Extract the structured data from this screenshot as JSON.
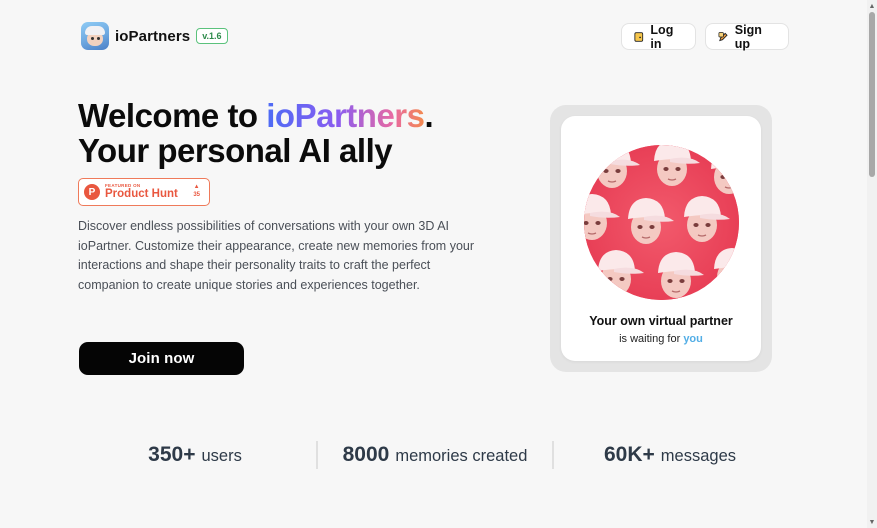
{
  "header": {
    "brand_name": "ioPartners",
    "version": "v.1.6",
    "login_label": "Log in",
    "signup_label": "Sign up"
  },
  "hero": {
    "title_prefix": "Welcome to ",
    "title_brand": "ioPartners",
    "title_suffix": ".",
    "title_line2": "Your personal AI ally",
    "description": "Discover endless possibilities of conversations with your own 3D AI ioPartner. Customize their appearance, create new memories from your interactions and shape their personality traits to craft the perfect companion to create unique stories and experiences together.",
    "join_label": "Join now"
  },
  "product_hunt": {
    "featured_text": "FEATURED ON",
    "name": "Product Hunt",
    "logo_letter": "P",
    "vote_arrow": "▲",
    "votes": "35"
  },
  "card": {
    "title": "Your own virtual partner",
    "sub_prefix": "is waiting for ",
    "sub_highlight": "you"
  },
  "stats": [
    {
      "number": "350+",
      "label": "users"
    },
    {
      "number": "8000",
      "label": "memories created"
    },
    {
      "number": "60K+",
      "label": "messages"
    }
  ],
  "colors": {
    "accent_gradient_start": "#4d6cf5",
    "accent_gradient_end": "#f38a4c",
    "product_hunt": "#e9573f",
    "version_badge": "#5bc27c",
    "avatar_bg": "#ef4a60",
    "highlight_you": "#53aee6"
  },
  "icons": {
    "login": "door-key-icon",
    "signup": "signup-pen-icon",
    "scroll_up": "▲",
    "scroll_down": "▼"
  }
}
